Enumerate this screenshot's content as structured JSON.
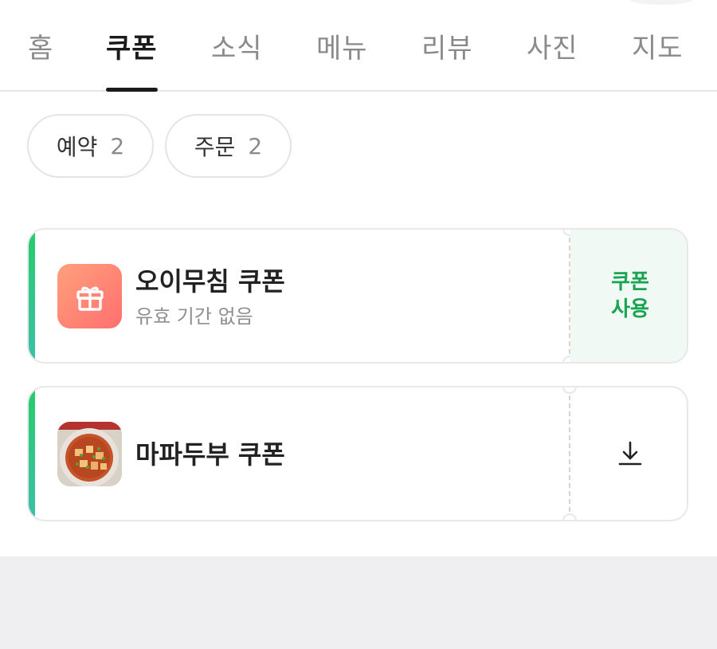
{
  "tabs": [
    {
      "label": "홈",
      "active": false
    },
    {
      "label": "쿠폰",
      "active": true
    },
    {
      "label": "소식",
      "active": false
    },
    {
      "label": "메뉴",
      "active": false
    },
    {
      "label": "리뷰",
      "active": false
    },
    {
      "label": "사진",
      "active": false
    },
    {
      "label": "지도",
      "active": false
    }
  ],
  "filters": [
    {
      "label": "예약",
      "count": "2"
    },
    {
      "label": "주문",
      "count": "2"
    }
  ],
  "coupons": [
    {
      "title": "오이무침 쿠폰",
      "subtitle": "유효 기간 없음",
      "thumb_icon": "gift-icon",
      "action": "쿠폰 사용",
      "action_line1": "쿠폰",
      "action_line2": "사용"
    },
    {
      "title": "마파두부 쿠폰",
      "thumb_icon": "mapo-tofu-photo",
      "action_icon": "download-icon"
    }
  ],
  "colors": {
    "accent_green": "#18a451",
    "active_tab": "#1a1a1a",
    "inactive_tab": "#8a8a8a",
    "footer_bg": "#efeff1"
  }
}
